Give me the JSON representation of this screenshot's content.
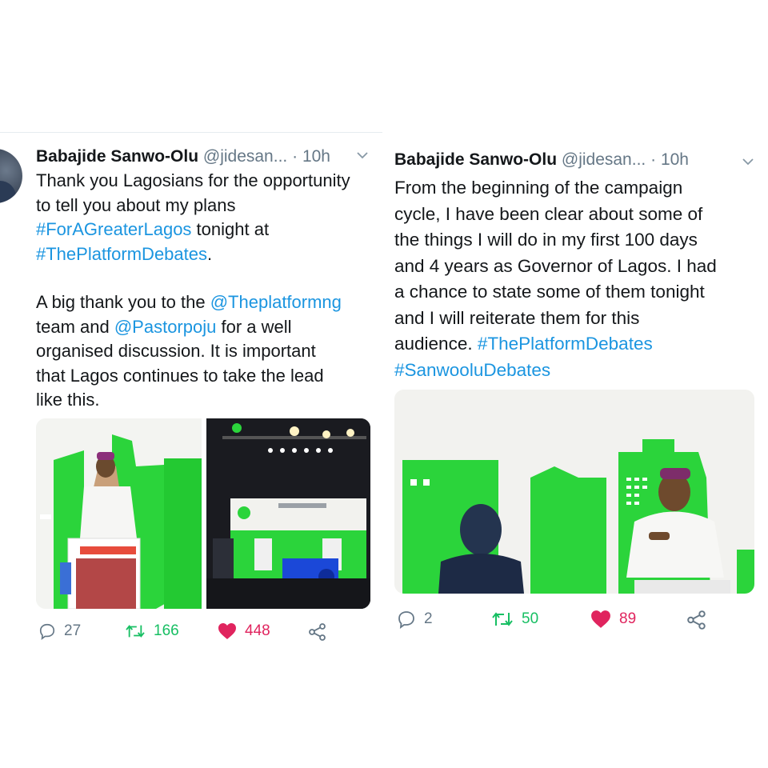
{
  "tweets": [
    {
      "author": "Babajide Sanwo-Olu",
      "handle": "@jidesan...",
      "separator": "·",
      "time": "10h",
      "lines": [
        [
          {
            "t": "Thank you Lagosians for the opportunity"
          }
        ],
        [
          {
            "t": "to tell you about my plans"
          }
        ],
        [
          {
            "t": "#ForAGreaterLagos",
            "link": true
          },
          {
            "t": " tonight at"
          }
        ],
        [
          {
            "t": "#ThePlatformDebates",
            "link": true
          },
          {
            "t": "."
          }
        ],
        [],
        [
          {
            "t": "A big thank you to the "
          },
          {
            "t": "@Theplatformng",
            "link": true
          }
        ],
        [
          {
            "t": "team and "
          },
          {
            "t": "@Pastorpoju",
            "link": true
          },
          {
            "t": " for a well"
          }
        ],
        [
          {
            "t": "organised discussion. It is important"
          }
        ],
        [
          {
            "t": "that Lagos continues to take the lead"
          }
        ],
        [
          {
            "t": "like this."
          }
        ]
      ],
      "counts": {
        "replies": "27",
        "retweets": "166",
        "likes": "448"
      }
    },
    {
      "author": "Babajide Sanwo-Olu",
      "handle": "@jidesan...",
      "separator": "·",
      "time": "10h",
      "lines": [
        [
          {
            "t": "From the beginning of the campaign"
          }
        ],
        [
          {
            "t": "cycle, I have been clear about some of"
          }
        ],
        [
          {
            "t": "the things I will do in my first 100 days"
          }
        ],
        [
          {
            "t": "and 4 years as Governor of Lagos. I had"
          }
        ],
        [
          {
            "t": "a chance to state some of them tonight"
          }
        ],
        [
          {
            "t": "and I will reiterate them for this"
          }
        ],
        [
          {
            "t": "audience. "
          },
          {
            "t": "#ThePlatformDebates",
            "link": true
          }
        ],
        [
          {
            "t": "#SanwooluDebates",
            "link": true
          }
        ]
      ],
      "counts": {
        "replies": "2",
        "retweets": "50",
        "likes": "89"
      }
    }
  ],
  "icons": {
    "reply": "reply-icon",
    "retweet": "retweet-icon",
    "like": "heart-icon",
    "share": "share-icon",
    "menu": "chevron-down-icon"
  },
  "colors": {
    "link": "#1b95e0",
    "like": "#e0245e",
    "retweet": "#17bf63",
    "muted": "#657786",
    "stage_green": "#2bd43b"
  }
}
